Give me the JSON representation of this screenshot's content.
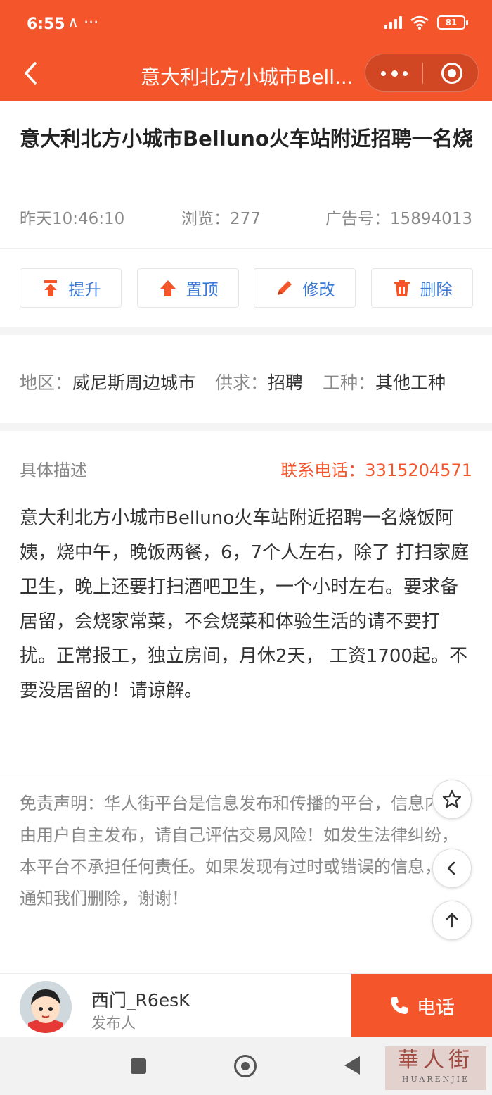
{
  "status_bar": {
    "time": "6:55",
    "extra": "∧ ···",
    "battery": "81"
  },
  "nav": {
    "title": "意大利北方小城市Bell..."
  },
  "post": {
    "title": "意大利北方小城市Belluno火车站附近招聘一名烧",
    "time": "昨天10:46:10",
    "views": "浏览：277",
    "ad_number": "广告号：15894013"
  },
  "actions": [
    {
      "label": "提升",
      "icon": "boost-icon"
    },
    {
      "label": "置顶",
      "icon": "pin-top-icon"
    },
    {
      "label": "修改",
      "icon": "edit-icon"
    },
    {
      "label": "删除",
      "icon": "trash-icon"
    }
  ],
  "info": {
    "region_label": "地区：",
    "region": "威尼斯周边城市",
    "type_label": "供求：",
    "type": "招聘",
    "job_label": "工种：",
    "job": "其他工种"
  },
  "description": {
    "label": "具体描述",
    "phone": "联系电话：3315204571",
    "body": "意大利北方小城市Belluno火车站附近招聘一名烧饭阿姨，烧中午，晚饭两餐，6，7个人左右，除了 打扫家庭卫生，晚上还要打扫酒吧卫生，一个小时左右。要求备居留，会烧家常菜，不会烧菜和体验生活的请不要打扰。正常报工，独立房间，月休2天， 工资1700起。不要没居留的！请谅解。"
  },
  "disclaimer": {
    "text": "免责声明：华人街平台是信息发布和传播的平台，信息内容由用户自主发布，请自己评估交易风险！如发生法律纠纷，本平台不承担任何责任。如果发现有过时或错误的信息，请通知我们删除，谢谢！"
  },
  "publisher": {
    "name": "西门_R6esK",
    "role": "发布人"
  },
  "call_button": {
    "label": "电话"
  },
  "watermark": {
    "cn": "華人街",
    "en": "HUARENJIE"
  },
  "colors": {
    "brand": "#f4552b",
    "action_text": "#3a78d8"
  }
}
